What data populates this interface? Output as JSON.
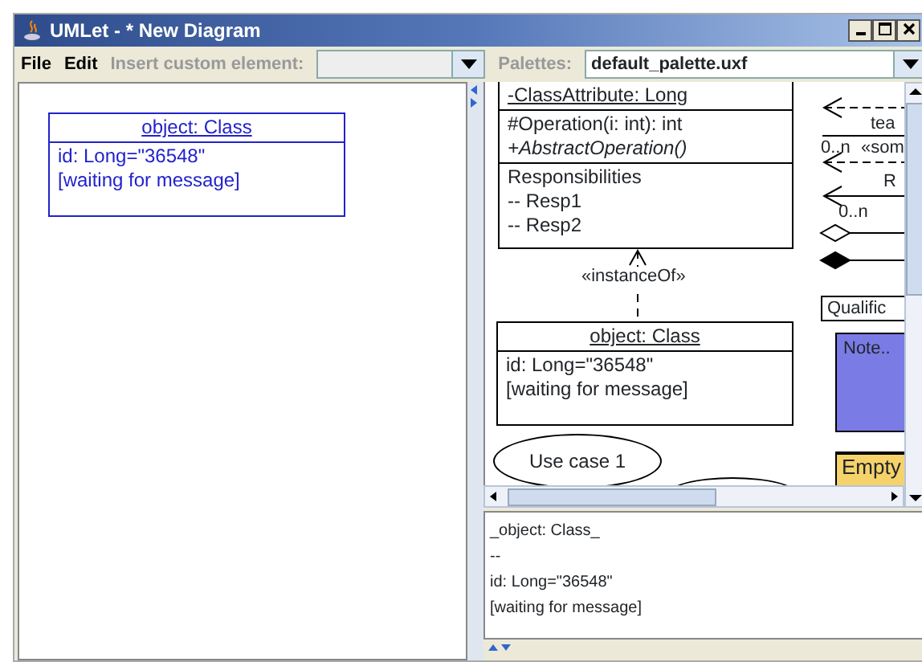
{
  "window": {
    "title": "UMLet - * New Diagram"
  },
  "menu": [
    {
      "label": "File",
      "disabled": false
    },
    {
      "label": "Edit",
      "disabled": false
    },
    {
      "label": "Insert custom element:",
      "disabled": true
    }
  ],
  "palettes": {
    "label": "Palettes:",
    "value": "default_palette.uxf"
  },
  "diagram": {
    "elements": [
      {
        "kind": "object",
        "title": "object: Class",
        "lines": [
          "id: Long=\"36548\"",
          "[waiting for message]"
        ],
        "selected": true
      }
    ]
  },
  "palette": {
    "elements": [
      {
        "kind": "class",
        "attributes": [
          "-ClassAttribute: Long"
        ],
        "operations": [
          {
            "text": "#Operation(i: int): int",
            "abstract": false
          },
          {
            "text": "+AbstractOperation()",
            "abstract": true
          }
        ],
        "responsibilities": [
          "Responsibilities",
          "-- Resp1",
          "-- Resp2"
        ]
      },
      {
        "kind": "dependency",
        "label": "«instanceOf»"
      },
      {
        "kind": "object",
        "title": "object: Class",
        "lines": [
          "id: Long=\"36548\"",
          "[waiting for message]"
        ],
        "selected": false
      },
      {
        "kind": "usecase",
        "label": "Use case 1"
      },
      {
        "kind": "usecase"
      },
      {
        "kind": "dashed-arrow"
      },
      {
        "kind": "text",
        "label": "tea"
      },
      {
        "kind": "line"
      },
      {
        "kind": "text",
        "label": "0..n"
      },
      {
        "kind": "text",
        "label": "«som"
      },
      {
        "kind": "dashed-arrow"
      },
      {
        "kind": "solid-arrow"
      },
      {
        "kind": "text",
        "label": "R"
      },
      {
        "kind": "text",
        "label": "0..n"
      },
      {
        "kind": "aggregation"
      },
      {
        "kind": "composition"
      },
      {
        "kind": "qualifier",
        "label": "Qualific"
      },
      {
        "kind": "note",
        "label": "Note..",
        "color": "#7b7be6"
      },
      {
        "kind": "package",
        "label": "Empty",
        "color": "#f5d36a"
      }
    ]
  },
  "editor": {
    "lines": [
      "_object: Class_",
      "--",
      "id: Long=\"36548\"",
      "[waiting for message]"
    ]
  }
}
